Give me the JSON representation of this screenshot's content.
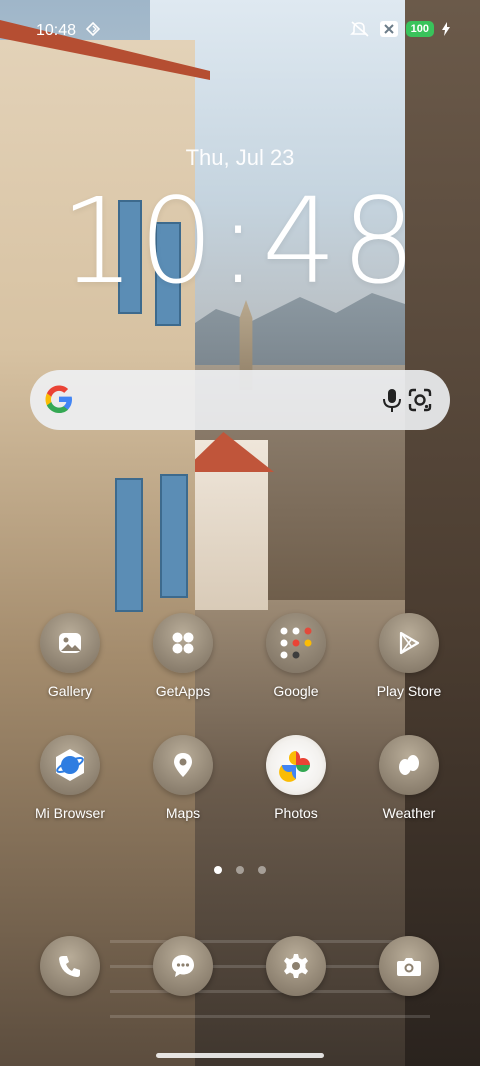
{
  "status_bar": {
    "time": "10:48",
    "battery": "100",
    "icons": [
      "data-saver-icon",
      "mute-icon",
      "close-box-icon",
      "charging-icon"
    ]
  },
  "lockscreen": {
    "date": "Thu, Jul 23",
    "clock": "10:48"
  },
  "search_bar": {
    "icons": [
      "google-logo-icon",
      "microphone-icon",
      "google-lens-icon"
    ]
  },
  "apps": {
    "row1": [
      {
        "label": "Gallery",
        "icon": "gallery-icon"
      },
      {
        "label": "GetApps",
        "icon": "getapps-icon"
      },
      {
        "label": "Google",
        "icon": "google-folder-icon"
      },
      {
        "label": "Play Store",
        "icon": "play-store-icon"
      }
    ],
    "row2": [
      {
        "label": "Mi Browser",
        "icon": "browser-icon"
      },
      {
        "label": "Maps",
        "icon": "maps-icon"
      },
      {
        "label": "Photos",
        "icon": "photos-icon"
      },
      {
        "label": "Weather",
        "icon": "weather-icon"
      }
    ]
  },
  "page_indicator": {
    "pages": 3,
    "current": 1
  },
  "dock": [
    {
      "icon": "phone-icon"
    },
    {
      "icon": "messages-icon"
    },
    {
      "icon": "settings-icon"
    },
    {
      "icon": "camera-icon"
    }
  ]
}
